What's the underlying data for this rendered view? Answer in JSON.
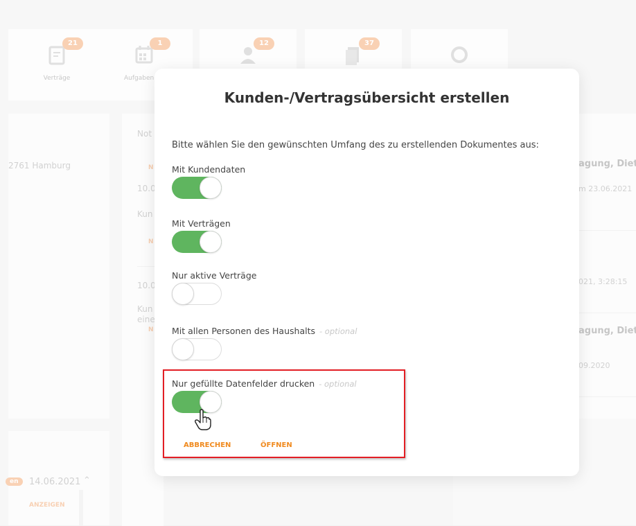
{
  "background": {
    "tiles": [
      {
        "label": "Verträge",
        "badge": "21",
        "icon": "contract-icon"
      },
      {
        "label": "Aufgaben",
        "badge": "1",
        "icon": "calendar-icon"
      },
      {
        "label": "",
        "badge": "12",
        "icon": "people-icon"
      },
      {
        "label": "",
        "badge": "37",
        "icon": "documents-icon"
      },
      {
        "label": "",
        "badge": "",
        "icon": "ring-icon"
      }
    ],
    "address": "2761 Hamburg",
    "notes": {
      "heading": "Not",
      "link1": "N",
      "date1": "10.0",
      "text1": "Kun",
      "link2": "N",
      "date2": "10.0",
      "text2a": "Kun",
      "text2b": "eine",
      "link3": "N"
    },
    "right_items": [
      {
        "title": "agung, Diet",
        "sub": "m 23.06.2021"
      },
      {
        "title": "",
        "sub": "021, 3:28:15"
      },
      {
        "title": "agung, Diet",
        "sub": "09.2020"
      }
    ],
    "bottom_badge": "en",
    "bottom_date": "14.06.2021",
    "bottom_link": "ANZEIGEN",
    "colors": {
      "badge": "#f6b98d",
      "link": "#f4b78a"
    }
  },
  "modal": {
    "title": "Kunden-/Vertragsübersicht erstellen",
    "description": "Bitte wählen Sie den gewünschten Umfang des zu erstellenden Dokumentes aus:",
    "options": [
      {
        "label": "Mit Kundendaten",
        "optional": "",
        "checked": true
      },
      {
        "label": "Mit Verträgen",
        "optional": "",
        "checked": true
      },
      {
        "label": "Nur aktive Verträge",
        "optional": "",
        "checked": false
      },
      {
        "label": "Mit allen Personen des Haushalts",
        "optional": "- optional",
        "checked": false
      },
      {
        "label": "Nur gefüllte Datenfelder drucken",
        "optional": "- optional",
        "checked": true
      }
    ],
    "cancel_label": "ABBRECHEN",
    "open_label": "ÖFFNEN",
    "colors": {
      "toggle_on": "#5fb55f",
      "action": "#f08a1e",
      "highlight": "#e31e24"
    }
  }
}
